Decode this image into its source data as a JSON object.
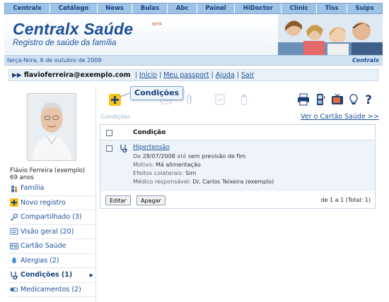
{
  "nav": {
    "items": [
      "Centralx",
      "Catálogo",
      "News",
      "Bulas",
      "Abc",
      "Painel",
      "HiDoctor",
      "Clinic",
      "Tiss",
      "Suips"
    ]
  },
  "header": {
    "title": "Centralx Saúde",
    "beta": "BETA",
    "subtitle": "Registro de saúde da família"
  },
  "datebar": {
    "date": "terça-feira, 6 de outubro de 2009",
    "brand": "Centralx"
  },
  "userbar": {
    "email": "flavioferreira@exemplo.com",
    "links": [
      "Início",
      "Meu passport",
      "Ajuda",
      "Sair"
    ]
  },
  "profile": {
    "name": "Flávio Ferreira (exemplo)",
    "age": "69 anos"
  },
  "sidebar": {
    "items": [
      {
        "label": "Família",
        "icon": "family-icon"
      },
      {
        "label": "Novo registro",
        "icon": "plus-icon"
      },
      {
        "label": "Compartilhado (3)",
        "icon": "share-key-icon"
      },
      {
        "label": "Visão geral (20)",
        "icon": "overview-icon"
      },
      {
        "label": "Cartão Saúde",
        "icon": "id-card-icon"
      },
      {
        "label": "Alergias (2)",
        "icon": "allergy-icon"
      },
      {
        "label": "Condições (1)",
        "icon": "stethoscope-icon"
      },
      {
        "label": "Medicamentos (2)",
        "icon": "pill-icon"
      }
    ],
    "active_index": 6
  },
  "main": {
    "tooltip": "Condições",
    "section_label": "Condições",
    "health_card_link": "Ver o Cartão Saúde >>",
    "table": {
      "column": "Condição",
      "row": {
        "name": "Hipertensão",
        "date_prefix": "De",
        "date": "28/07/2008",
        "until": "até",
        "end": "sem previsão de fim",
        "motive_label": "Motivo:",
        "motive": "Má alimentação",
        "side_effects_label": "Efeitos colaterais:",
        "side_effects": "Sim",
        "doctor_label": "Médico responsável:",
        "doctor": "Dr. Carlos Teixeira (exemplo)"
      }
    },
    "edit_label": "Editar",
    "delete_label": "Apagar",
    "pagination": "de 1 a 1 (Total: 1)"
  },
  "colors": {
    "brand_blue": "#1c4f96",
    "nav_bg": "#9fc3e7",
    "accent_yellow": "#f2c318"
  }
}
